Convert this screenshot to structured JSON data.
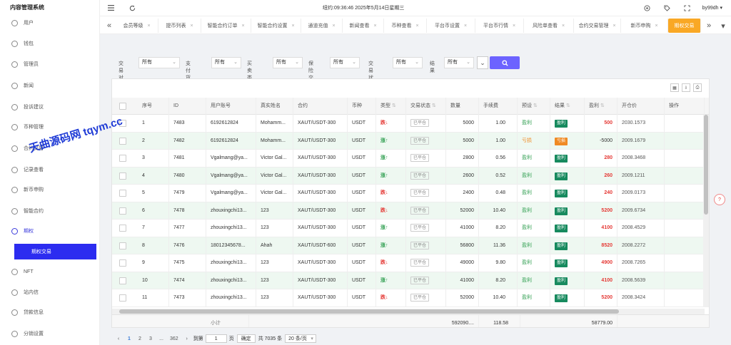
{
  "app": {
    "title": "内容管理系统"
  },
  "sidebar": {
    "items": [
      {
        "label": "用户",
        "icon": "user-icon"
      },
      {
        "label": "钱包",
        "icon": "wallet-icon"
      },
      {
        "label": "管理员",
        "icon": "admin-icon"
      },
      {
        "label": "新闻",
        "icon": "news-icon"
      },
      {
        "label": "投诉建议",
        "icon": "feedback-icon"
      },
      {
        "label": "币种管理",
        "icon": "coin-icon"
      },
      {
        "label": "合约交易",
        "icon": "contract-icon"
      },
      {
        "label": "记录查看",
        "icon": "record-icon"
      },
      {
        "label": "新币申购",
        "icon": "newcoin-icon"
      },
      {
        "label": "智能合约",
        "icon": "smart-contract-icon"
      },
      {
        "label": "期权",
        "icon": "option-icon"
      },
      {
        "label": "NFT",
        "icon": "nft-icon"
      },
      {
        "label": "站内信",
        "icon": "message-icon"
      },
      {
        "label": "贷款信息",
        "icon": "loan-icon"
      },
      {
        "label": "分销设置",
        "icon": "distribution-icon"
      }
    ],
    "active_sub": "期权交易"
  },
  "topbar": {
    "datetime": "纽约:09:36:46 2025年5月14日星期三",
    "user": "by99dh"
  },
  "tabs": [
    {
      "label": "会员等级"
    },
    {
      "label": "提币列表"
    },
    {
      "label": "智能合约订单"
    },
    {
      "label": "智能合约设置"
    },
    {
      "label": "通道充值"
    },
    {
      "label": "新闻查看"
    },
    {
      "label": "币种查看"
    },
    {
      "label": "平台币设置"
    },
    {
      "label": "平台币行情"
    },
    {
      "label": "风险单查看"
    },
    {
      "label": "合约交易管理"
    },
    {
      "label": "新币申购"
    },
    {
      "label": "期权交易"
    }
  ],
  "filters": [
    {
      "label": "交易对",
      "value": "所有"
    },
    {
      "label": "支付货币",
      "value": "所有"
    },
    {
      "label": "买卖类型",
      "value": "所有"
    },
    {
      "label": "保险交易",
      "value": "所有"
    },
    {
      "label": "交易状态",
      "value": "所有"
    },
    {
      "label": "结果",
      "value": "所有"
    }
  ],
  "table": {
    "headers": [
      "序号",
      "ID",
      "用户账号",
      "真实姓名",
      "合约",
      "币种",
      "类型",
      "交易状态",
      "数量",
      "手续费",
      "预设",
      "结果",
      "盈利",
      "开仓价",
      "操作"
    ],
    "rows": [
      {
        "idx": "1",
        "id": "7483",
        "account": "6192612824",
        "name": "Mohamm...",
        "contract": "XAUT/USDT-300",
        "coin": "USDT",
        "type": "跌",
        "dir": "down",
        "state": "已平仓",
        "qty": "5000",
        "fee": "1.00",
        "preset": "盈利",
        "preset_kind": "win",
        "result": "盈利",
        "result_kind": "win",
        "profit": "500",
        "profit_kind": "pos",
        "open": "2030.1573"
      },
      {
        "idx": "2",
        "id": "7482",
        "account": "6192612824",
        "name": "Mohamm...",
        "contract": "XAUT/USDT-300",
        "coin": "USDT",
        "type": "涨",
        "dir": "up",
        "state": "已平仓",
        "qty": "5000",
        "fee": "1.00",
        "preset": "亏损",
        "preset_kind": "lose",
        "result": "亏损",
        "result_kind": "lose",
        "profit": "-5000",
        "profit_kind": "neg",
        "open": "2009.1679"
      },
      {
        "idx": "3",
        "id": "7481",
        "account": "Vgalmang@ya...",
        "name": "Victor Gal...",
        "contract": "XAUT/USDT-300",
        "coin": "USDT",
        "type": "涨",
        "dir": "up",
        "state": "已平仓",
        "qty": "2800",
        "fee": "0.56",
        "preset": "盈利",
        "preset_kind": "win",
        "result": "盈利",
        "result_kind": "win",
        "profit": "280",
        "profit_kind": "pos",
        "open": "2008.3468"
      },
      {
        "idx": "4",
        "id": "7480",
        "account": "Vgalmang@ya...",
        "name": "Victor Gal...",
        "contract": "XAUT/USDT-300",
        "coin": "USDT",
        "type": "涨",
        "dir": "up",
        "state": "已平仓",
        "qty": "2600",
        "fee": "0.52",
        "preset": "盈利",
        "preset_kind": "win",
        "result": "盈利",
        "result_kind": "win",
        "profit": "260",
        "profit_kind": "pos",
        "open": "2009.1211"
      },
      {
        "idx": "5",
        "id": "7479",
        "account": "Vgalmang@ya...",
        "name": "Victor Gal...",
        "contract": "XAUT/USDT-300",
        "coin": "USDT",
        "type": "跌",
        "dir": "down",
        "state": "已平仓",
        "qty": "2400",
        "fee": "0.48",
        "preset": "盈利",
        "preset_kind": "win",
        "result": "盈利",
        "result_kind": "win",
        "profit": "240",
        "profit_kind": "pos",
        "open": "2009.0173"
      },
      {
        "idx": "6",
        "id": "7478",
        "account": "zhouxingchi13...",
        "name": "123",
        "contract": "XAUT/USDT-300",
        "coin": "USDT",
        "type": "跌",
        "dir": "down",
        "state": "已平仓",
        "qty": "52000",
        "fee": "10.40",
        "preset": "盈利",
        "preset_kind": "win",
        "result": "盈利",
        "result_kind": "win",
        "profit": "5200",
        "profit_kind": "pos",
        "open": "2009.6734"
      },
      {
        "idx": "7",
        "id": "7477",
        "account": "zhouxingchi13...",
        "name": "123",
        "contract": "XAUT/USDT-300",
        "coin": "USDT",
        "type": "涨",
        "dir": "up",
        "state": "已平仓",
        "qty": "41000",
        "fee": "8.20",
        "preset": "盈利",
        "preset_kind": "win",
        "result": "盈利",
        "result_kind": "win",
        "profit": "4100",
        "profit_kind": "pos",
        "open": "2008.4529"
      },
      {
        "idx": "8",
        "id": "7476",
        "account": "18012345678...",
        "name": "Ahah",
        "contract": "XAUT/USDT-600",
        "coin": "USDT",
        "type": "涨",
        "dir": "up",
        "state": "已平仓",
        "qty": "56800",
        "fee": "11.36",
        "preset": "盈利",
        "preset_kind": "win",
        "result": "盈利",
        "result_kind": "win",
        "profit": "8520",
        "profit_kind": "pos",
        "open": "2008.2272"
      },
      {
        "idx": "9",
        "id": "7475",
        "account": "zhouxingchi13...",
        "name": "123",
        "contract": "XAUT/USDT-300",
        "coin": "USDT",
        "type": "跌",
        "dir": "down",
        "state": "已平仓",
        "qty": "49000",
        "fee": "9.80",
        "preset": "盈利",
        "preset_kind": "win",
        "result": "盈利",
        "result_kind": "win",
        "profit": "4900",
        "profit_kind": "pos",
        "open": "2008.7265"
      },
      {
        "idx": "10",
        "id": "7474",
        "account": "zhouxingchi13...",
        "name": "123",
        "contract": "XAUT/USDT-300",
        "coin": "USDT",
        "type": "涨",
        "dir": "up",
        "state": "已平仓",
        "qty": "41000",
        "fee": "8.20",
        "preset": "盈利",
        "preset_kind": "win",
        "result": "盈利",
        "result_kind": "win",
        "profit": "4100",
        "profit_kind": "pos",
        "open": "2008.5639"
      },
      {
        "idx": "11",
        "id": "7473",
        "account": "zhouxingchi13...",
        "name": "123",
        "contract": "XAUT/USDT-300",
        "coin": "USDT",
        "type": "跌",
        "dir": "down",
        "state": "已平仓",
        "qty": "52000",
        "fee": "10.40",
        "preset": "盈利",
        "preset_kind": "win",
        "result": "盈利",
        "result_kind": "win",
        "profit": "5200",
        "profit_kind": "pos",
        "open": "2008.3424"
      }
    ],
    "summary": {
      "label": "小计",
      "qty": "592090....",
      "fee": "118.58",
      "profit": "58779.00"
    }
  },
  "pager": {
    "pages": [
      "1",
      "2",
      "3",
      "...",
      "362"
    ],
    "goto_label": "到第",
    "goto_value": "1",
    "page_unit": "页",
    "confirm_label": "确定",
    "total": "共 7035 条",
    "page_size": "20 条/页"
  },
  "watermark": "天曲源码网 tqym.cc",
  "colors": {
    "accent": "#2c2cf0",
    "active_tab": "#f9a825",
    "search_button": "#6c63ff",
    "profit": "#e53935",
    "win_tag": "#178a5e",
    "lose_tag": "#f08a24"
  }
}
